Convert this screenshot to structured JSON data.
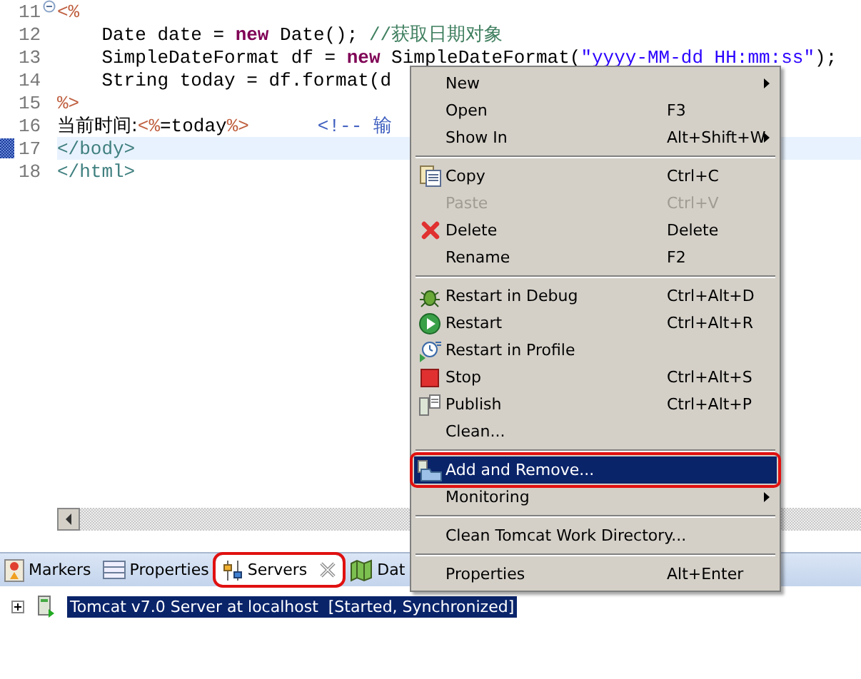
{
  "editor": {
    "lines": [
      {
        "number": "11",
        "folded": true,
        "tokens": [
          {
            "kind": "jsp",
            "text": "<%"
          }
        ]
      },
      {
        "number": "12",
        "tokens": [
          {
            "kind": "plain",
            "text": "    Date date = "
          },
          {
            "kind": "keyword",
            "text": "new"
          },
          {
            "kind": "plain",
            "text": " Date(); "
          },
          {
            "kind": "comment",
            "text": "//获取日期对象"
          }
        ]
      },
      {
        "number": "13",
        "tokens": [
          {
            "kind": "plain",
            "text": "    SimpleDateFormat df = "
          },
          {
            "kind": "keyword",
            "text": "new"
          },
          {
            "kind": "plain",
            "text": " SimpleDateFormat("
          },
          {
            "kind": "string",
            "text": "\"yyyy-MM-dd HH:mm:ss\""
          },
          {
            "kind": "plain",
            "text": ");"
          }
        ]
      },
      {
        "number": "14",
        "tokens": [
          {
            "kind": "plain",
            "text": "    String today = df.format(d"
          }
        ]
      },
      {
        "number": "15",
        "tokens": [
          {
            "kind": "jsp",
            "text": "%>"
          }
        ]
      },
      {
        "number": "16",
        "tokens": [
          {
            "kind": "cn",
            "text": "当前时间:"
          },
          {
            "kind": "jsp",
            "text": "<%"
          },
          {
            "kind": "plain",
            "text": "=today"
          },
          {
            "kind": "jsp",
            "text": "%>"
          },
          {
            "kind": "htmlcomment",
            "text": "<!-- 输"
          }
        ]
      },
      {
        "number": "17",
        "marker": true,
        "current": true,
        "tokens": [
          {
            "kind": "tag",
            "text": "</body>"
          }
        ]
      },
      {
        "number": "18",
        "tokens": [
          {
            "kind": "tag",
            "text": "</html>"
          }
        ]
      }
    ]
  },
  "views": {
    "tabs": [
      {
        "label": "Markers",
        "selected": false
      },
      {
        "label": "Properties",
        "selected": false
      },
      {
        "label": "Servers",
        "selected": true,
        "highlighted": true,
        "closable": true
      },
      {
        "label": "Dat",
        "selected": false
      }
    ],
    "servers": [
      {
        "label": "Tomcat v7.0 Server at localhost  [Started, Synchronized]",
        "expanded": false,
        "selected": true
      }
    ]
  },
  "context_menu": {
    "items": [
      {
        "kind": "item",
        "label": "New",
        "submenu": true,
        "selected": false
      },
      {
        "kind": "item",
        "label": "Open",
        "shortcut": "F3",
        "selected": false
      },
      {
        "kind": "item",
        "label": "Show In",
        "shortcut": "Alt+Shift+W",
        "submenu": true,
        "selected": false
      },
      {
        "kind": "separator"
      },
      {
        "kind": "item",
        "label": "Copy",
        "shortcut": "Ctrl+C",
        "selected": false
      },
      {
        "kind": "item",
        "label": "Paste",
        "shortcut": "Ctrl+V",
        "disabled": true,
        "selected": false
      },
      {
        "kind": "item",
        "label": "Delete",
        "shortcut": "Delete",
        "selected": false
      },
      {
        "kind": "item",
        "label": "Rename",
        "shortcut": "F2",
        "selected": false
      },
      {
        "kind": "separator"
      },
      {
        "kind": "item",
        "label": "Restart in Debug",
        "shortcut": "Ctrl+Alt+D",
        "selected": false
      },
      {
        "kind": "item",
        "label": "Restart",
        "shortcut": "Ctrl+Alt+R",
        "selected": false
      },
      {
        "kind": "item",
        "label": "Restart in Profile",
        "selected": false
      },
      {
        "kind": "item",
        "label": "Stop",
        "shortcut": "Ctrl+Alt+S",
        "selected": false
      },
      {
        "kind": "item",
        "label": "Publish",
        "shortcut": "Ctrl+Alt+P",
        "selected": false
      },
      {
        "kind": "item",
        "label": "Clean...",
        "selected": false
      },
      {
        "kind": "separator"
      },
      {
        "kind": "item",
        "label": "Add and Remove...",
        "selected": true,
        "highlighted": true
      },
      {
        "kind": "item",
        "label": "Monitoring",
        "submenu": true,
        "selected": false
      },
      {
        "kind": "separator"
      },
      {
        "kind": "item",
        "label": "Clean Tomcat Work Directory...",
        "selected": false
      },
      {
        "kind": "separator"
      },
      {
        "kind": "item",
        "label": "Properties",
        "shortcut": "Alt+Enter",
        "selected": false
      }
    ]
  }
}
